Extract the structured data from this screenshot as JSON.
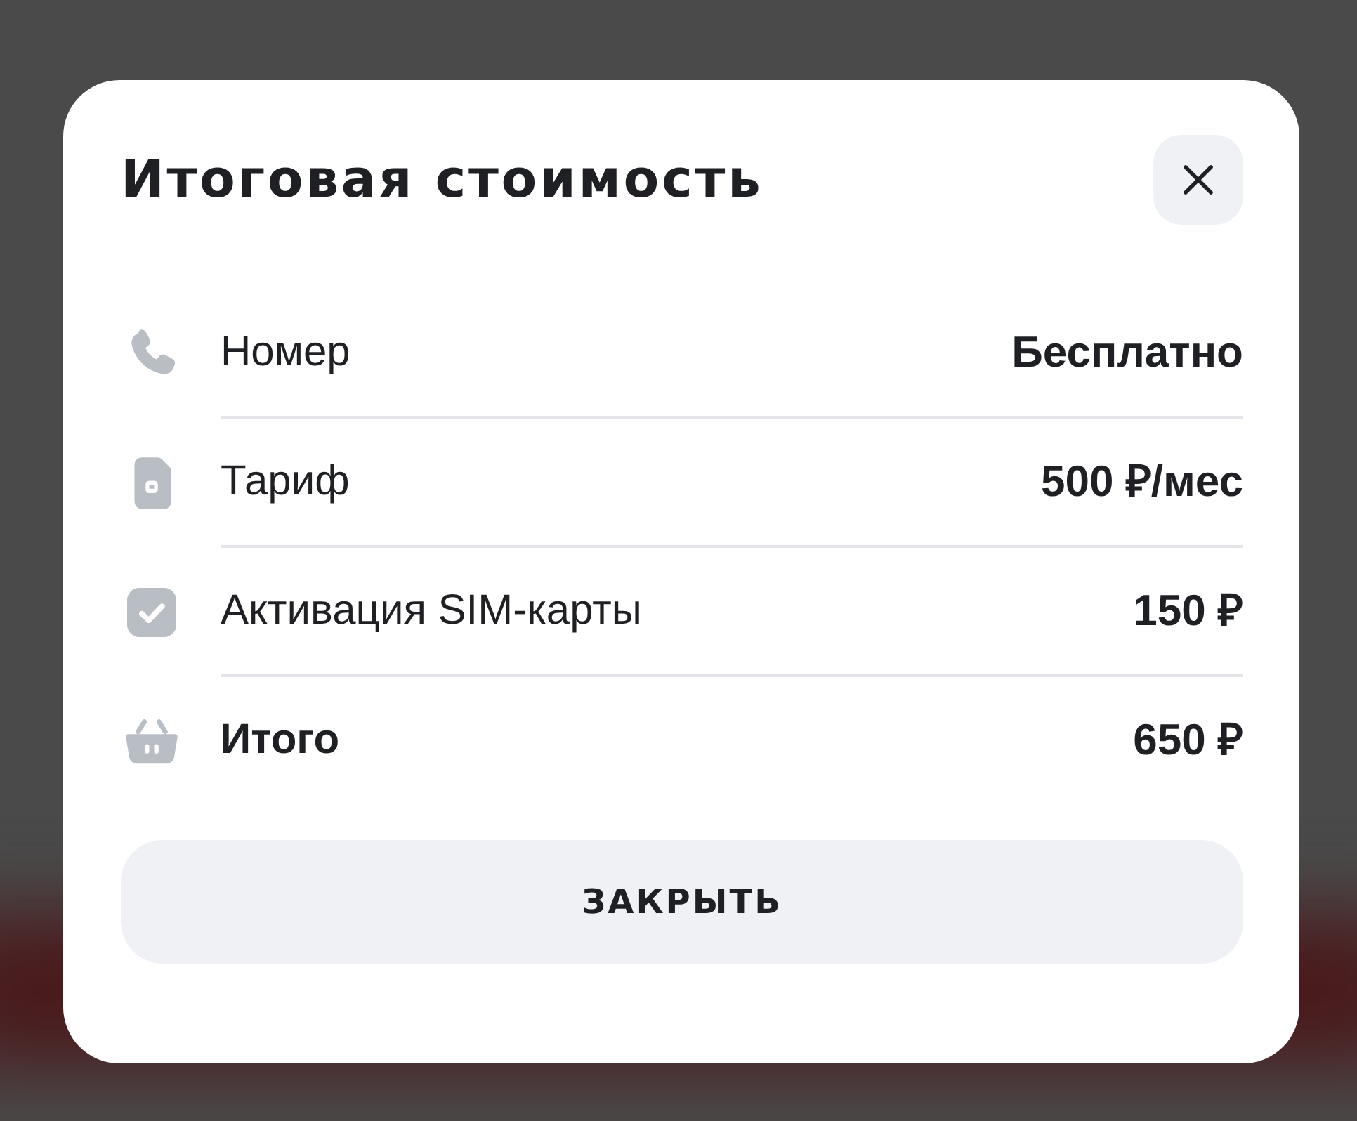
{
  "dialog": {
    "title": "Итоговая стоимость"
  },
  "rows": [
    {
      "kind": "phone",
      "label": "Номер",
      "value": "Бесплатно",
      "total": false
    },
    {
      "kind": "sim",
      "label": "Тариф",
      "value": "500 ₽/мес",
      "total": false
    },
    {
      "kind": "check",
      "label": "Активация SIM-карты",
      "value": "150 ₽",
      "total": false
    },
    {
      "kind": "basket",
      "label": "Итого",
      "value": "650 ₽",
      "total": true
    }
  ],
  "footer_button": {
    "label": "ЗАКРЫТЬ"
  }
}
